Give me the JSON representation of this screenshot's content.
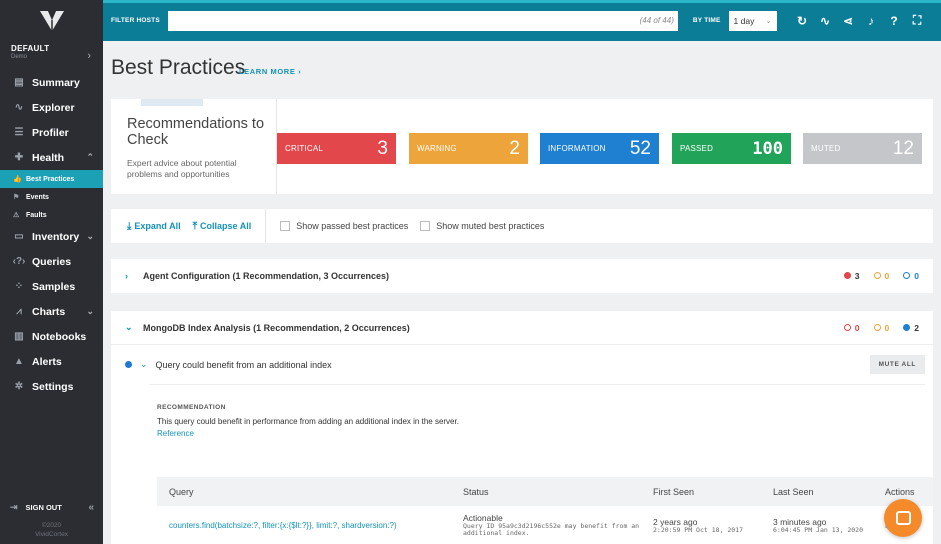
{
  "sidebar": {
    "env_name": "DEFAULT",
    "env_sub": "Demo",
    "nav": [
      {
        "label": "Summary",
        "icon": "summary-icon"
      },
      {
        "label": "Explorer",
        "icon": "explorer-icon"
      },
      {
        "label": "Profiler",
        "icon": "profiler-icon"
      },
      {
        "label": "Health",
        "icon": "health-icon"
      },
      {
        "label": "Inventory",
        "icon": "inventory-icon"
      },
      {
        "label": "Queries",
        "icon": "queries-icon"
      },
      {
        "label": "Samples",
        "icon": "samples-icon"
      },
      {
        "label": "Charts",
        "icon": "charts-icon"
      },
      {
        "label": "Notebooks",
        "icon": "notebooks-icon"
      },
      {
        "label": "Alerts",
        "icon": "alerts-icon"
      },
      {
        "label": "Settings",
        "icon": "settings-icon"
      }
    ],
    "health_sub": [
      "Best Practices",
      "Events",
      "Faults"
    ],
    "sign_out": "SIGN OUT",
    "copyright_year": "©2020",
    "copyright_name": "VividCortex"
  },
  "topbar": {
    "filter_label": "FILTER HOSTS",
    "filter_count": "(44 of 44)",
    "by_time_label": "BY TIME",
    "time_value": "1 day"
  },
  "page": {
    "title": "Best Practices",
    "learn_more": "LEARN MORE ›"
  },
  "summary": {
    "title": "Recommendations to Check",
    "description": "Expert advice about potential problems and opportunities",
    "tiles": [
      {
        "label": "CRITICAL",
        "count": "3",
        "color": "#e2474c"
      },
      {
        "label": "WARNING",
        "count": "2",
        "color": "#eda43a"
      },
      {
        "label": "INFORMATION",
        "count": "52",
        "color": "#1f7fd1"
      },
      {
        "label": "PASSED",
        "count": "100",
        "color": "#22a35a"
      },
      {
        "label": "MUTED",
        "count": "12",
        "color": "#c4c6c9"
      }
    ]
  },
  "toolbar": {
    "expand_all": "Expand All",
    "collapse_all": "Collapse All",
    "show_passed": "Show passed best practices",
    "show_muted": "Show muted best practices"
  },
  "sections": [
    {
      "title": "Agent Configuration (1 Recommendation, 3 Occurrences)",
      "critical": "3",
      "warning": "0",
      "info": "0"
    },
    {
      "title": "MongoDB Index Analysis (1 Recommendation, 2 Occurrences)",
      "critical": "0",
      "warning": "0",
      "info": "2"
    }
  ],
  "finding": {
    "title": "Query could benefit from an additional index",
    "mute_all": "MUTE ALL",
    "rec_label": "RECOMMENDATION",
    "rec_text": "This query could benefit in performance from adding an additional index in the server.",
    "reference": "Reference"
  },
  "table": {
    "headers": [
      "Query",
      "Status",
      "First Seen",
      "Last Seen",
      "Actions"
    ],
    "row": {
      "query": "counters.find(batchsize:?, filter:{x:{$lt:?}}, limit:?, shardversion:?)",
      "status": "Actionable",
      "status_detail": "Query ID 95a9c3d2196c552e may benefit from an additional index.",
      "first_seen": "2 years ago",
      "first_seen_ts": "2:20:59 PM Oct 18, 2017",
      "last_seen": "3 minutes ago",
      "last_seen_ts": "6:04:45 PM Jan 13, 2020",
      "action": "Mute"
    }
  },
  "colors": {
    "sidebar_bg": "#2b2d33",
    "topbar_bg": "#0c7d97",
    "accent": "#1592b6",
    "active_nav": "#1ba0b5"
  }
}
